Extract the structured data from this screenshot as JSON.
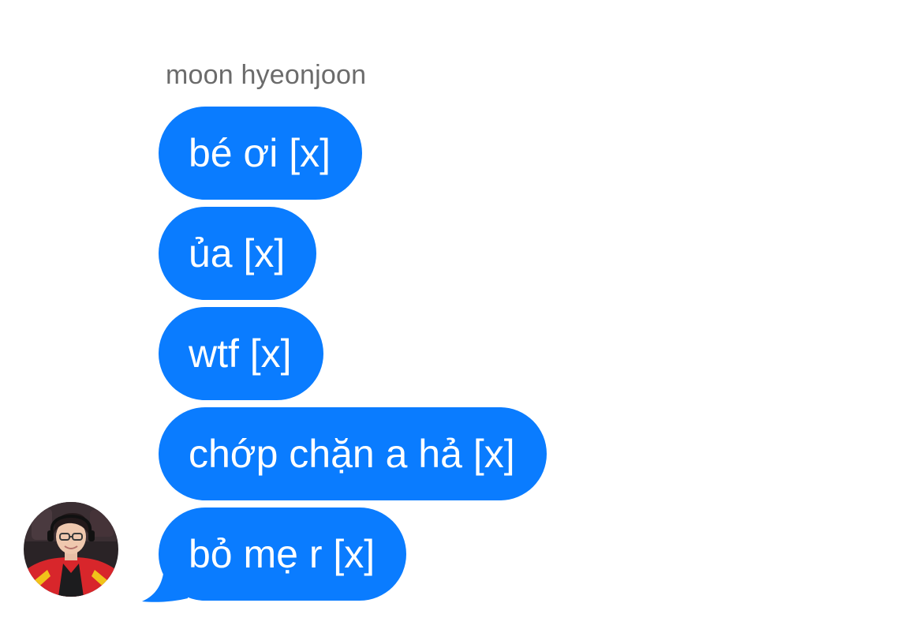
{
  "thread": {
    "sender_name": "moon hyeonjoon",
    "messages": [
      {
        "text": "bé ơi [x]"
      },
      {
        "text": "ủa [x]"
      },
      {
        "text": "wtf [x]"
      },
      {
        "text": "chớp chặn a hả [x]"
      },
      {
        "text": "bỏ mẹ r [x]"
      }
    ]
  },
  "colors": {
    "bubble": "#0a7cff",
    "bubble_text": "#ffffff",
    "sender_name": "#6b6b6b"
  },
  "avatar": {
    "icon": "user-photo-avatar"
  }
}
